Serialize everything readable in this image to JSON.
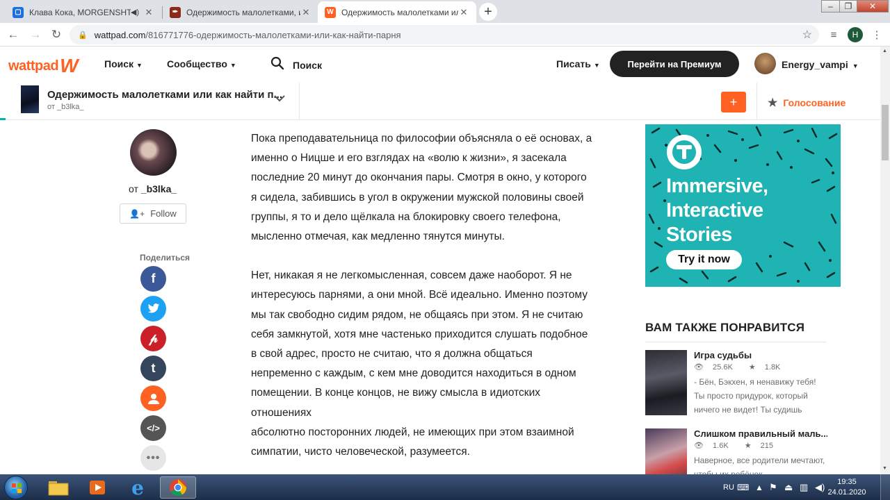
{
  "browser": {
    "tabs": [
      {
        "title": "Клава Кока, MORGENSHTERN",
        "has_audio": true
      },
      {
        "title": "Одержимость малолетками, или",
        "has_audio": false
      },
      {
        "title": "Одержимость малолетками или",
        "has_audio": false,
        "active": true
      }
    ],
    "url_host": "wattpad.com",
    "url_path": "/816771776-одержимость-малолетками-или-как-найти-парня",
    "profile_initial": "H"
  },
  "header": {
    "logo": "wattpad",
    "nav": [
      "Поиск",
      "Сообщество"
    ],
    "search_label": "Поиск",
    "write_label": "Писать",
    "premium_label": "Перейти на Премиум",
    "username": "Energy_vampi"
  },
  "story": {
    "title": "Одержимость малолетками или как найти п...",
    "author_line": "от _b3lka_",
    "plus_label": "+",
    "vote_label": "Голосование"
  },
  "author": {
    "by": "от",
    "name": "_b3lka_",
    "follow_label": "Follow"
  },
  "share": {
    "label": "Поделиться",
    "items": [
      "facebook",
      "twitter",
      "pinterest",
      "tumblr",
      "profile",
      "embed",
      "more"
    ]
  },
  "article": {
    "paragraphs": [
      "Пока преподавательница по философии объясняла о её основах, а\nименно о Ницше и его взглядах на «волю к жизни», я засекала\nпоследние 20 минут до окончания пары. Смотря в окно, у которого\nя сидела, забившись в угол в окружении мужской половины своей\nгруппы, я то и дело щёлкала на блокировку своего телефона,\nмысленно отмечая, как медленно тянутся минуты.",
      "Нет, никакая я не легкомысленная, совсем даже наоборот. Я не\nинтересуюсь парнями, а они мной. Всё идеально. Именно поэтому\nмы так свободно сидим рядом, не общаясь при этом. Я не считаю\nсебя замкнутой, хотя мне частенько приходится слушать подобное\nв свой адрес, просто не считаю, что я должна общаться\nнепременно с каждым, с кем мне доводится находиться в одном\nпомещении. В конце концов, не вижу смысла в идиотских\nотношениях\nабсолютно посторонних людей, не имеющих при этом взаимной\nсимпатии, чисто человеческой, разумеется."
    ]
  },
  "ad": {
    "headline_1": "Immersive,",
    "headline_2": "Interactive",
    "headline_3": "Stories",
    "cta": "Try it now"
  },
  "recommendations": {
    "title": "ВАМ ТАКЖЕ ПОНРАВИТСЯ",
    "items": [
      {
        "title": "Игра судьбы",
        "reads": "25.6K",
        "votes": "1.8K",
        "desc": "- Бён, Бэкхен, я ненавижу тебя! Ты просто придурок, который ничего не видет! Ты судишь"
      },
      {
        "title": "Слишком правильный маль...",
        "reads": "1.6K",
        "votes": "215",
        "desc": "Наверное, все родители мечтают, чтобы их ребёнок"
      }
    ]
  },
  "taskbar": {
    "lang": "RU",
    "time": "19:35",
    "date": "24.01.2020"
  }
}
